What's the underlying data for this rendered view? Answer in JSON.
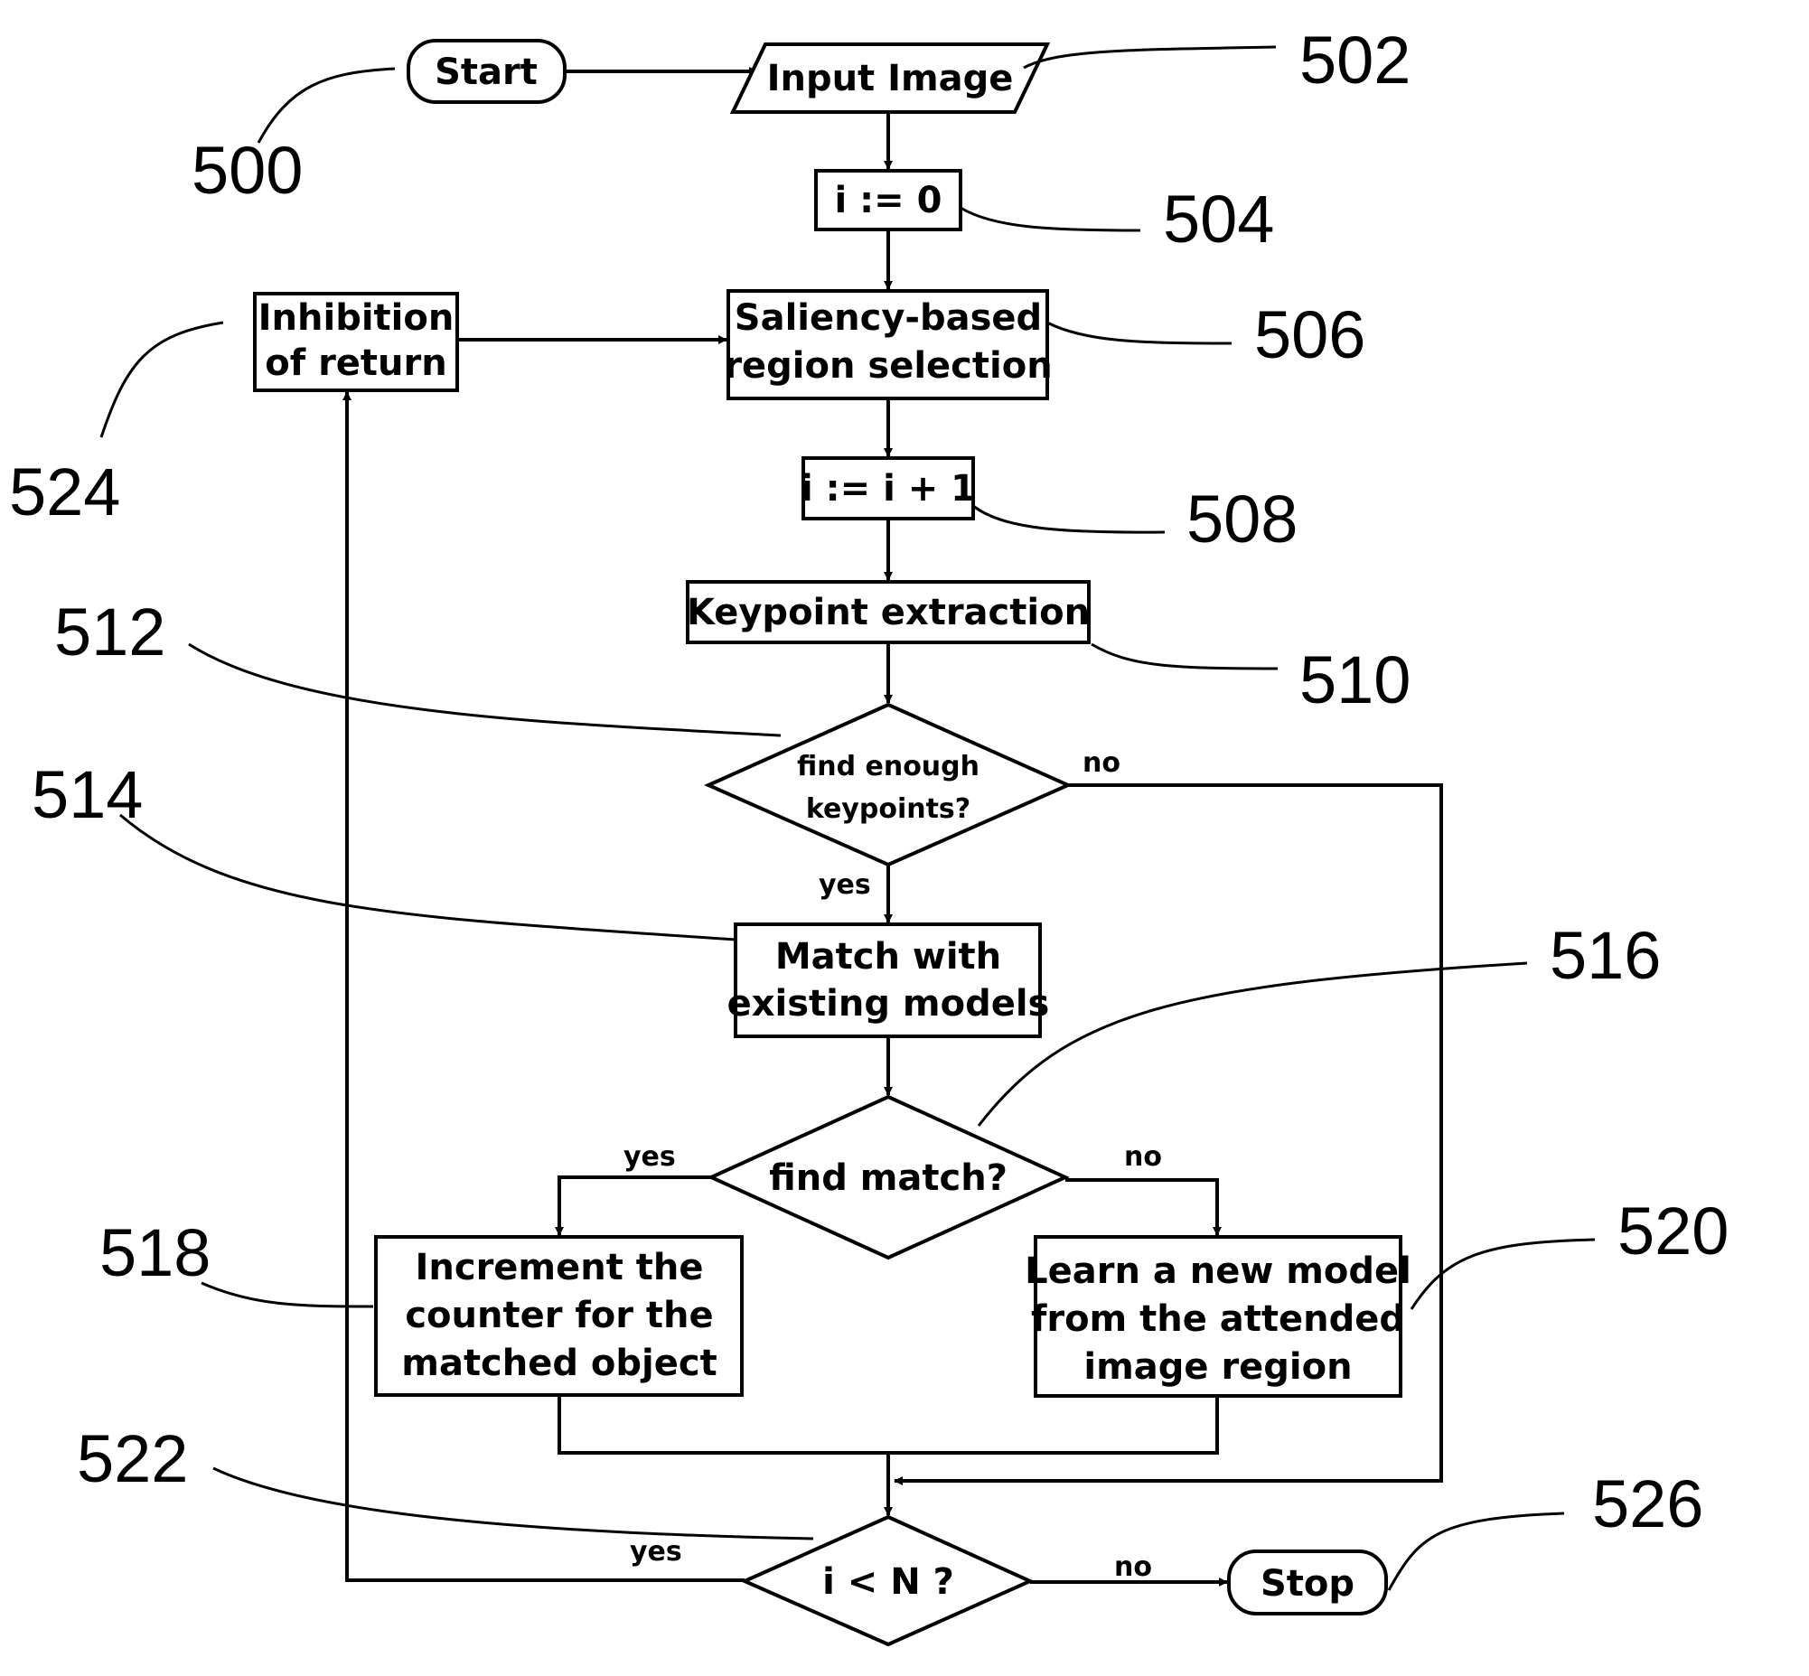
{
  "diagram": {
    "type": "flowchart",
    "nodes": {
      "start": {
        "label": "Start",
        "ref": "500"
      },
      "input_image": {
        "label": "Input Image",
        "ref": "502"
      },
      "init_i": {
        "label": "i := 0",
        "ref": "504"
      },
      "saliency": {
        "lines": [
          "Saliency-based",
          "region selection"
        ],
        "ref": "506"
      },
      "increment_i": {
        "label": "i := i + 1",
        "ref": "508"
      },
      "keypoint": {
        "label": "Keypoint extraction",
        "ref": "510"
      },
      "enough_keypoints": {
        "lines": [
          "find enough",
          "keypoints?"
        ],
        "ref": "512"
      },
      "match_models": {
        "lines": [
          "Match with",
          "existing models"
        ],
        "ref": "514"
      },
      "find_match": {
        "label": "find match?",
        "ref": "516"
      },
      "increment_counter": {
        "lines": [
          "Increment the",
          "counter for the",
          "matched object"
        ],
        "ref": "518"
      },
      "learn_model": {
        "lines": [
          "Learn a new model",
          "from the attended",
          "image region"
        ],
        "ref": "520"
      },
      "loop_check": {
        "label": "i < N ?",
        "ref": "522"
      },
      "inhibition": {
        "lines": [
          "Inhibition",
          "of return"
        ],
        "ref": "524"
      },
      "stop": {
        "label": "Stop",
        "ref": "526"
      }
    },
    "edge_labels": {
      "keypoints_no": "no",
      "keypoints_yes": "yes",
      "match_yes": "yes",
      "match_no": "no",
      "loop_yes": "yes",
      "loop_no": "no"
    }
  }
}
